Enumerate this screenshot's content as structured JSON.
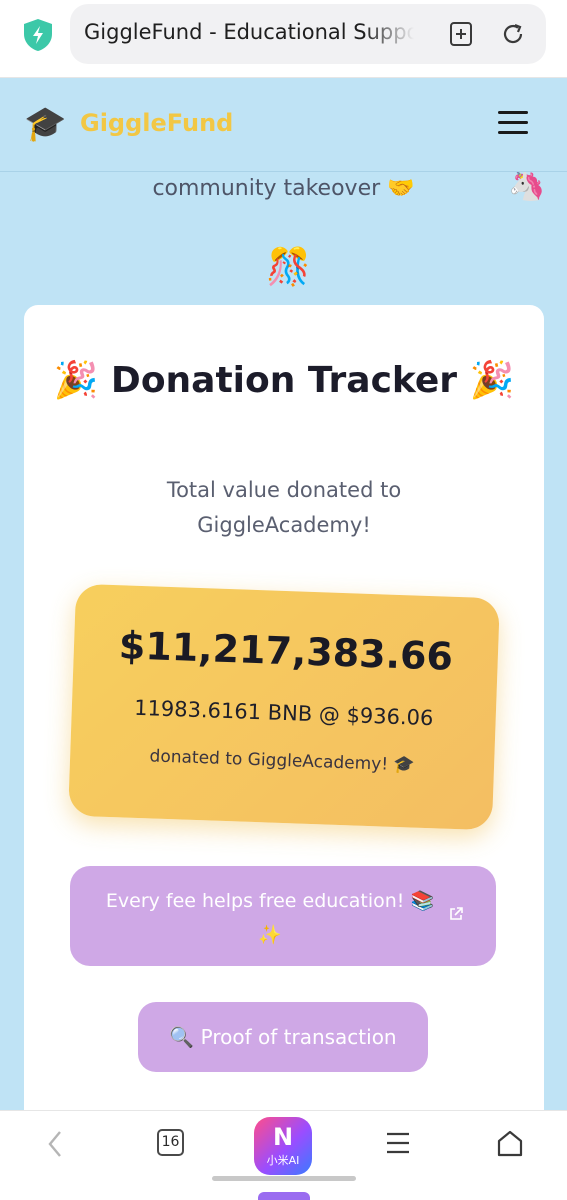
{
  "browser": {
    "url_title": "GiggleFund - Educational Support",
    "shield_icon": "shield-check-icon",
    "add_page_icon": "add-bookmark-icon",
    "reload_icon": "reload-icon"
  },
  "header": {
    "brand_icon": "🎓",
    "brand_name": "GiggleFund",
    "menu_icon": "hamburger-menu-icon"
  },
  "hero": {
    "takeover_text": "community takeover 🤝",
    "unicorn": "🦄",
    "confetti_ball": "🎊"
  },
  "tracker": {
    "title": "🎉 Donation Tracker 🎉",
    "subtitle": "Total value donated to GiggleAcademy!",
    "amount_usd": "$11,217,383.66",
    "bnb_line": "11983.6161 BNB @ $936.06",
    "note": "donated to GiggleAcademy! 🎓",
    "fee_button_label": "Every fee helps free education! 📚✨",
    "proof_button_label": "🔍 Proof of transaction"
  },
  "bottom_nav": {
    "back_icon": "back-arrow-icon",
    "tab_count": "16",
    "ai_letter": "N",
    "ai_label": "小米AI",
    "menu_icon": "menu-lines-icon",
    "home_icon": "home-icon"
  },
  "colors": {
    "page_background": "#bfe3f5",
    "brand_yellow": "#f2c744",
    "amount_box": "#f6c65e",
    "lavender_button": "#cfa8e6"
  }
}
